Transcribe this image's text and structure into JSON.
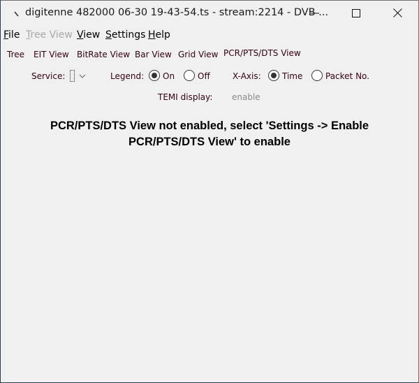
{
  "window": {
    "title": "digitenne 482000 06-30 19-43-54.ts - stream:2214 - DVB ...",
    "icons": {
      "app": "app-icon",
      "minimize": "minimize-icon",
      "maximize": "maximize-icon",
      "close": "close-icon"
    }
  },
  "menubar": {
    "items": [
      {
        "mnemonic": "F",
        "rest": "ile",
        "enabled": true
      },
      {
        "mnemonic": "T",
        "rest": "ree View",
        "enabled": false
      },
      {
        "mnemonic": "V",
        "rest": "iew",
        "enabled": true
      },
      {
        "mnemonic": "S",
        "rest": "ettings",
        "enabled": true
      },
      {
        "mnemonic": "H",
        "rest": "elp",
        "enabled": true
      }
    ]
  },
  "tabs": {
    "items": [
      "Tree",
      "EIT View",
      "BitRate View",
      "Bar View",
      "Grid View",
      "PCR/PTS/DTS View"
    ],
    "selected": "PCR/PTS/DTS View"
  },
  "controls": {
    "service_label": "Service:",
    "service_value": "",
    "legend_label": "Legend:",
    "legend_on": "On",
    "legend_off": "Off",
    "legend_selected": "On",
    "xaxis_label": "X-Axis:",
    "xaxis_time": "Time",
    "xaxis_packet": "Packet No.",
    "xaxis_selected": "Time"
  },
  "temi": {
    "label": "TEMI display:",
    "value": "enable"
  },
  "message": {
    "line1": "PCR/PTS/DTS View not enabled, select 'Settings -> Enable",
    "line2": "PCR/PTS/DTS View' to enable"
  }
}
